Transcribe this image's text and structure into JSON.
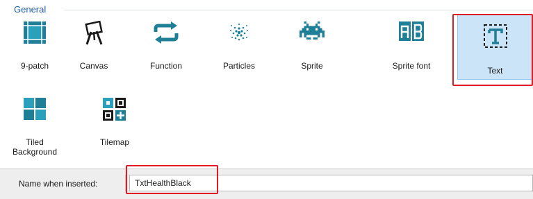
{
  "group": {
    "title": "General"
  },
  "objects": [
    {
      "label": "9-patch",
      "icon": "nine-patch-icon"
    },
    {
      "label": "Canvas",
      "icon": "canvas-easel-icon"
    },
    {
      "label": "Function",
      "icon": "function-arrows-icon"
    },
    {
      "label": "Particles",
      "icon": "particles-icon"
    },
    {
      "label": "Sprite",
      "icon": "sprite-invader-icon"
    },
    {
      "label": "Sprite font",
      "icon": "sprite-font-icon"
    },
    {
      "label": "Text",
      "icon": "text-icon",
      "selected": true
    },
    {
      "label": "Tiled\nBackground",
      "icon": "tiled-background-icon"
    },
    {
      "label": "Tilemap",
      "icon": "tilemap-icon"
    }
  ],
  "name_field": {
    "label": "Name when inserted:",
    "value": "TxtHealthBlack"
  },
  "colors": {
    "icon_teal": "#1e7f97",
    "highlight": "#e01b24",
    "selected_bg": "#cce4f7"
  }
}
